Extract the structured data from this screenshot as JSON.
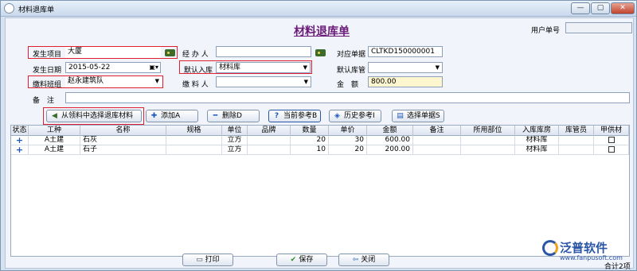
{
  "window": {
    "title": "材料退库单",
    "controls": [
      "—",
      "▢",
      "✕"
    ]
  },
  "header": {
    "form_title": "材料退库单",
    "user_no_label": "用户单号",
    "user_no_value": ""
  },
  "form": {
    "project_label": "发生项目",
    "project_value": "大厦",
    "handler_label": "经 办 人",
    "handler_value": "",
    "doc_label": "对应单据",
    "doc_value": "CLTKD150000001",
    "date_label": "发生日期",
    "date_value": "2015-05-22",
    "default_wh_label": "默认入库",
    "default_wh_value": "材料库",
    "default_keeper_label": "默认库管",
    "default_keeper_value": "",
    "team_label": "缴料班组",
    "team_value": "赵永建筑队",
    "payer_label": "缴 料 人",
    "payer_value": "",
    "amount_label": "金　额",
    "amount_value": "800.00",
    "remark_label": "备　注",
    "remark_value": ""
  },
  "toolbar": {
    "select_from_issue": "从领料中选择退库材料",
    "add": "添加A",
    "delete": "删除D",
    "current_ref": "当前参考B",
    "history_ref": "历史参考I",
    "select_doc": "选择单据S"
  },
  "grid": {
    "columns": [
      "状态",
      "工种",
      "名称",
      "规格",
      "单位",
      "品牌",
      "数量",
      "单价",
      "金额",
      "备注",
      "所用部位",
      "入库库房",
      "库管员",
      "甲供材"
    ],
    "rows": [
      {
        "status": "+",
        "trade": "A土建",
        "name": "石灰",
        "spec": "",
        "unit": "立方",
        "brand": "",
        "qty": "20",
        "price": "30",
        "amount": "600.00",
        "remark": "",
        "part": "",
        "warehouse": "材料库",
        "keeper": "",
        "owner_supplied": false
      },
      {
        "status": "+",
        "trade": "A土建",
        "name": "石子",
        "spec": "",
        "unit": "立方",
        "brand": "",
        "qty": "10",
        "price": "20",
        "amount": "200.00",
        "remark": "",
        "part": "",
        "warehouse": "材料库",
        "keeper": "",
        "owner_supplied": false
      }
    ]
  },
  "footer": {
    "print": "打印",
    "save": "保存",
    "close": "关闭",
    "total": "合计2项"
  },
  "watermark": {
    "text": "泛普软件",
    "url": "www.fanpusoft.com"
  },
  "colors": {
    "highlight": "#e02030",
    "title": "#6a1b7a",
    "brand": "#2b55a6"
  }
}
